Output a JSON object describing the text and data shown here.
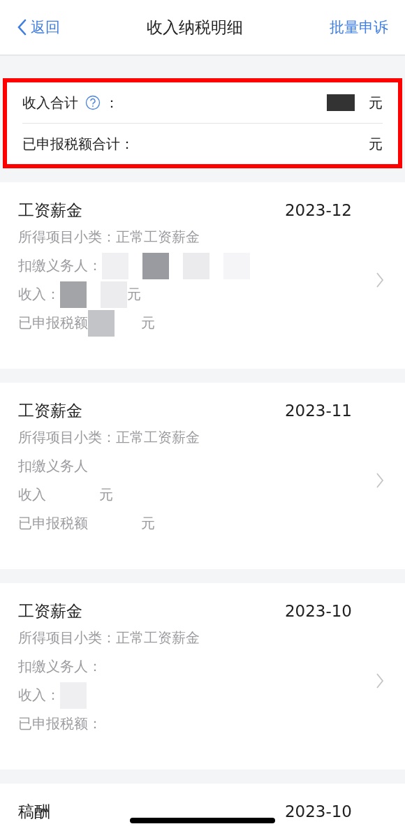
{
  "nav": {
    "back": "返回",
    "title": "收入纳税明细",
    "action": "批量申诉"
  },
  "summary": {
    "highlighted": true,
    "rows": [
      {
        "label": "收入合计",
        "help": true,
        "colon": "：",
        "redactions": [
          {
            "color": "#333333"
          }
        ],
        "unit": "元"
      },
      {
        "label": "已申报税额合计：",
        "unit": "元"
      }
    ]
  },
  "records": [
    {
      "title": "工资薪金",
      "date": "2023-12",
      "chevron": true,
      "fields": [
        {
          "label": "所得项目小类：",
          "value": "正常工资薪金"
        },
        {
          "label": "扣缴义务人：",
          "redactions": [
            {
              "color": "#f0f0f2"
            },
            {
              "color": "#9a9ba0"
            },
            {
              "color": "#ebebed"
            },
            {
              "color": "#f5f5f7"
            }
          ]
        },
        {
          "label": "收入：",
          "redactions": [
            {
              "color": "#a3a4a8"
            },
            {
              "color": "#ececee"
            }
          ],
          "unit": "元"
        },
        {
          "label": "已申报税额",
          "redactions": [
            {
              "color": "#c3c4c8"
            }
          ],
          "unit": "元"
        }
      ]
    },
    {
      "title": "工资薪金",
      "date": "2023-11",
      "chevron": true,
      "fields": [
        {
          "label": "所得项目小类：",
          "value": "正常工资薪金"
        },
        {
          "label": "扣缴义务人"
        },
        {
          "label": "收入",
          "unit": "元"
        },
        {
          "label": "已申报税额",
          "unit": "元"
        }
      ]
    },
    {
      "title": "工资薪金",
      "date": "2023-10",
      "chevron": true,
      "fields": [
        {
          "label": "所得项目小类：",
          "value": "正常工资薪金"
        },
        {
          "label": "扣缴义务人："
        },
        {
          "label": "收入：",
          "redactions": [
            {
              "color": "#efeff1"
            }
          ]
        },
        {
          "label": "已申报税额："
        }
      ]
    },
    {
      "title": "稿酬",
      "date": "2023-10",
      "chevron": false
    }
  ]
}
